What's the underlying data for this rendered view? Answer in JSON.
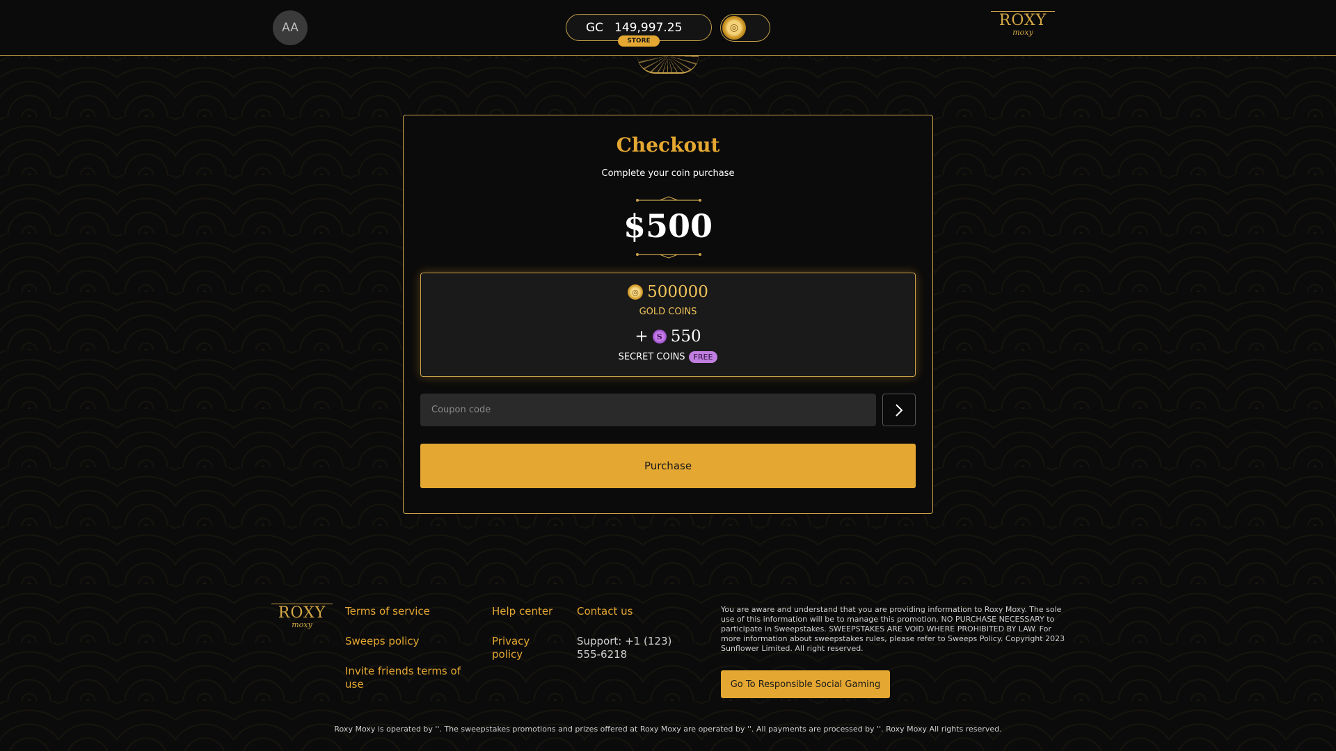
{
  "header": {
    "avatar_initials": "AA",
    "currency_code": "GC",
    "balance": "149,997.25",
    "store_label": "STORE",
    "brand_big": "ROXY",
    "brand_small": "moxy"
  },
  "checkout": {
    "title": "Checkout",
    "subtitle": "Complete your coin purchase",
    "price": "$500",
    "gold_amount": "500000",
    "gold_label": "GOLD COINS",
    "secret_plus": "+",
    "secret_amount": "550",
    "secret_label": "SECRET COINS",
    "free_badge": "FREE",
    "coupon_placeholder": "Coupon code",
    "purchase_label": "Purchase"
  },
  "footer": {
    "brand_big": "ROXY",
    "brand_small": "moxy",
    "links": {
      "terms": "Terms of service",
      "sweeps": "Sweeps policy",
      "invite": "Invite friends terms of use",
      "help": "Help center",
      "privacy": "Privacy policy",
      "contact": "Contact us"
    },
    "support": "Support: +1 (123) 555-6218",
    "legal": "You are aware and understand that you are providing information to Roxy Moxy. The sole use of this information will be to manage this promotion. NO PURCHASE NECESSARY to participate in Sweepstakes. SWEEPSTAKES ARE VOID WHERE PROHIBITED BY LAW. For more information about sweepstakes rules, please refer to Sweeps Policy. Copyright 2023 Sunflower Limited. All right reserved.",
    "rsg_label": "Go To Responsible Social Gaming",
    "bottom_text": "Roxy Moxy is operated by ''. The sweepstakes promotions and prizes offered at Roxy Moxy are operated by ''. All payments are processed by ''. Roxy Moxy All rights reserved."
  },
  "colors": {
    "accent": "#e4a731",
    "border_gold": "#c9a24a",
    "background": "#0b0b0b",
    "secret_purple": "#c07fe0"
  },
  "icons": [
    "gold-coin-icon",
    "secret-coin-icon",
    "chevron-right-icon"
  ]
}
